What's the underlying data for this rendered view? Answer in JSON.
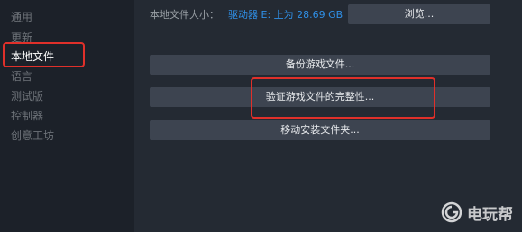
{
  "sidebar": {
    "items": [
      {
        "label": "通用"
      },
      {
        "label": "更新"
      },
      {
        "label": "本地文件"
      },
      {
        "label": "语言"
      },
      {
        "label": "测试版"
      },
      {
        "label": "控制器"
      },
      {
        "label": "创意工坊"
      }
    ],
    "active_index": 2
  },
  "local_files": {
    "size_label": "本地文件大小：",
    "size_value": "驱动器 E: 上为 28.69 GB",
    "browse_label": "浏览...",
    "backup_label": "备份游戏文件...",
    "verify_label": "验证游戏文件的完整性...",
    "move_label": "移动安装文件夹..."
  },
  "watermark": {
    "text": "电玩帮",
    "icon": "gamepad-logo-icon"
  },
  "colors": {
    "highlight": "#e0302a",
    "link": "#2f8fe6",
    "button_bg": "#3d4450"
  }
}
